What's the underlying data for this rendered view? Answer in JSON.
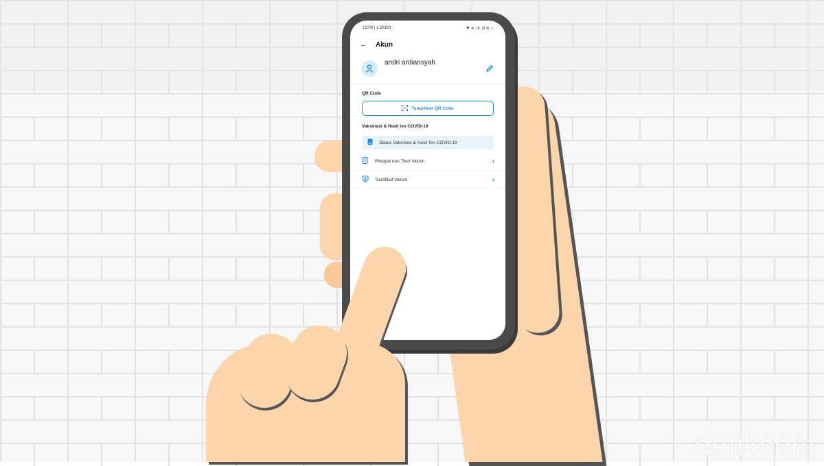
{
  "status_bar": {
    "left": "12:09 | 1,5KB/d",
    "right": "⚑ ∗ .ıll .ıll ≋ ▭"
  },
  "app_bar": {
    "title": "Akun"
  },
  "profile": {
    "name": "andri ardiansyah"
  },
  "qr_section": {
    "title": "QR Code",
    "button_label": "Tampilkan QR Code"
  },
  "vaccine_section": {
    "title": "Vaksinasi & Hasil tes COVID-19",
    "status_card_label": "Status Vaksinasi & Hasil Tes COVID-19",
    "items": [
      {
        "label": "Riwayat dan Tiket Vaksin"
      },
      {
        "label": "Sertifikat Vaksin"
      }
    ]
  },
  "watermark": {
    "text": "detikcom"
  },
  "colors": {
    "accent": "#1a8fd8",
    "skin": "#fcd5ac",
    "phone_frame": "#4a4a4a"
  }
}
